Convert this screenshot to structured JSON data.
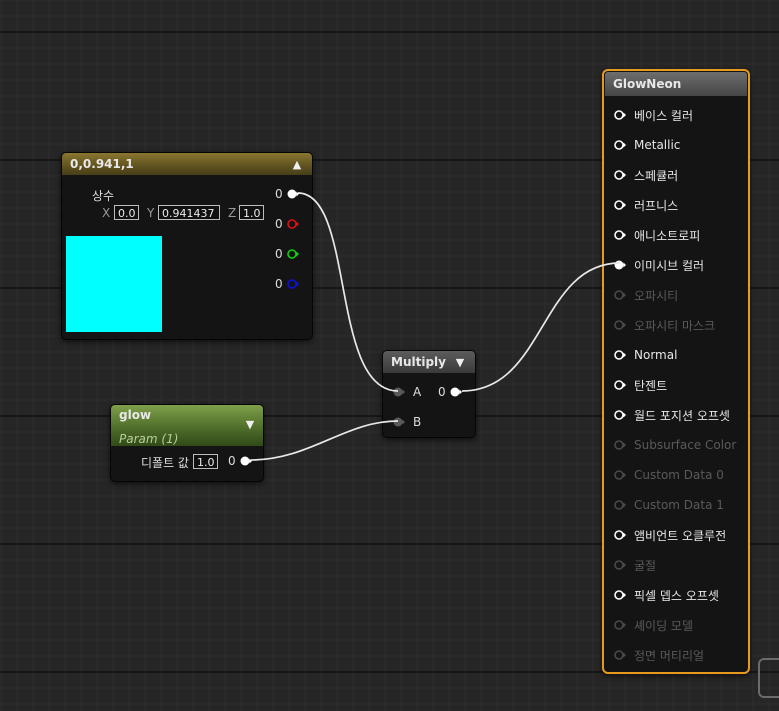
{
  "constant_node": {
    "title": "0,0.941,1",
    "row_label": "상수",
    "x_label": "X",
    "x_value": "0.0",
    "y_label": "Y",
    "y_value": "0.941437",
    "z_label": "Z",
    "z_value": "1.0",
    "outputs": [
      "0",
      "0",
      "0",
      "0"
    ],
    "swatch_color": "#00FFFF"
  },
  "multiply_node": {
    "title": "Multiply",
    "input_a": "A",
    "input_b": "B",
    "output": "0"
  },
  "glow_node": {
    "title": "glow",
    "subtitle": "Param (1)",
    "default_label": "디폴트 값",
    "default_value": "1.0",
    "output": "0"
  },
  "material_node": {
    "title": "GlowNeon",
    "inputs": [
      {
        "label": "베이스 컬러",
        "enabled": true
      },
      {
        "label": "Metallic",
        "enabled": true
      },
      {
        "label": "스페큘러",
        "enabled": true
      },
      {
        "label": "러프니스",
        "enabled": true
      },
      {
        "label": "애니소트로피",
        "enabled": true
      },
      {
        "label": "이미시브 컬러",
        "enabled": true
      },
      {
        "label": "오파시티",
        "enabled": false
      },
      {
        "label": "오파시티 마스크",
        "enabled": false
      },
      {
        "label": "Normal",
        "enabled": true
      },
      {
        "label": "탄젠트",
        "enabled": true
      },
      {
        "label": "월드 포지션 오프셋",
        "enabled": true
      },
      {
        "label": "Subsurface Color",
        "enabled": false
      },
      {
        "label": "Custom Data 0",
        "enabled": false
      },
      {
        "label": "Custom Data 1",
        "enabled": false
      },
      {
        "label": "앰비언트 오클루전",
        "enabled": true
      },
      {
        "label": "굴절",
        "enabled": false
      },
      {
        "label": "픽셀 뎁스 오프셋",
        "enabled": true
      },
      {
        "label": "셰이딩 모델",
        "enabled": false
      },
      {
        "label": "정면 머티리얼",
        "enabled": false
      }
    ]
  },
  "colors": {
    "background": "#262626",
    "selection_outline": "#E69B1E",
    "pin_red": "#E01010",
    "pin_green": "#10D010",
    "pin_blue": "#1010E0",
    "wire": "#E8E8E8"
  }
}
